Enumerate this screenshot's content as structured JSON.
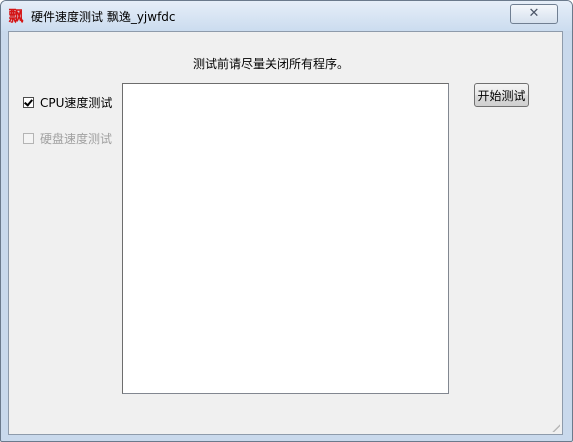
{
  "window": {
    "title": "硬件速度测试 飘逸_yjwfdc",
    "app_icon_glyph": "飘",
    "close_glyph": "✕"
  },
  "main": {
    "notice": "测试前请尽量关闭所有程序。",
    "options": [
      {
        "label": "CPU速度测试",
        "checked": true,
        "enabled": true
      },
      {
        "label": "硬盘速度测试",
        "checked": false,
        "enabled": false
      }
    ],
    "output_text": "",
    "start_button_label": "开始测试"
  },
  "colors": {
    "client_bg": "#f0f0f0",
    "icon_red": "#d41414",
    "disabled_text": "#a0a0a0"
  }
}
